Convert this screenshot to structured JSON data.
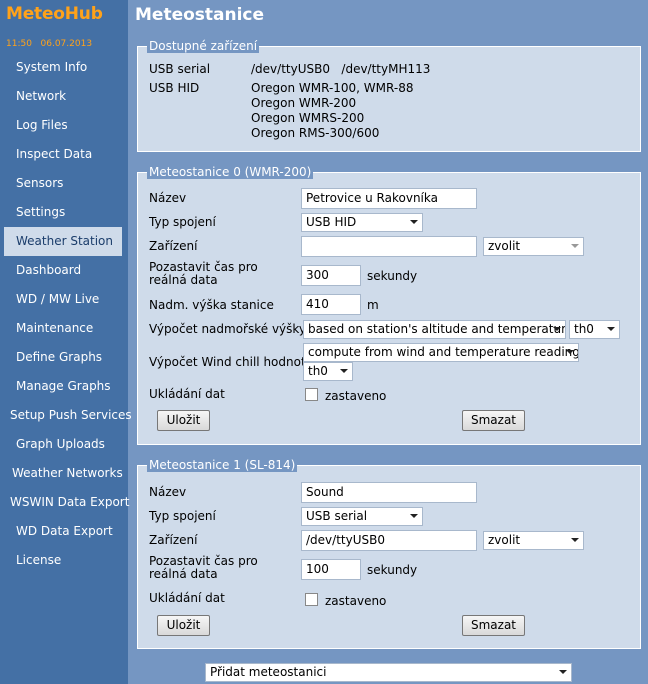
{
  "app": {
    "logo": "MeteoHub",
    "clock": "11:50   06.07.2013"
  },
  "header": {
    "title": "Meteostanice"
  },
  "sidebar": {
    "items": [
      "System Info",
      "Network",
      "Log Files",
      "Inspect Data",
      "Sensors",
      "Settings",
      "Weather Station",
      "Dashboard",
      "WD / MW Live",
      "Maintenance",
      "Define Graphs",
      "Manage Graphs",
      "Setup Push Services",
      "Graph Uploads",
      "Weather Networks",
      "WSWIN Data Export",
      "WD Data Export",
      "License"
    ],
    "active": "Weather Station"
  },
  "devices": {
    "legend": "Dostupné zařízení",
    "usb_serial_label": "USB serial",
    "usb_serial_value": "/dev/ttyUSB0   /dev/ttyMH113",
    "usb_hid_label": "USB HID",
    "usb_hid_values": [
      "Oregon WMR-100, WMR-88",
      "Oregon WMR-200",
      "Oregon WMRS-200",
      "Oregon RMS-300/600"
    ]
  },
  "station0": {
    "legend": "Meteostanice 0 (WMR-200)",
    "name_label": "Název",
    "name_value": "Petrovice u Rakovníka",
    "conn_label": "Typ spojení",
    "conn_value": "USB HID",
    "device_label": "Zařízení",
    "device_value": "",
    "device_select": "zvolit",
    "pause_label": "Pozastavit čas pro reálná data",
    "pause_value": "300",
    "pause_unit": "sekundy",
    "alt_label": "Nadm. výška stanice",
    "alt_value": "410",
    "alt_unit": "m",
    "calc_alt_label": "Výpočet nadmořské výšky",
    "calc_alt_value": "based on station's altitude and temperature",
    "calc_alt_sensor": "th0",
    "windchill_label": "Výpočet Wind chill hodnoty",
    "windchill_value": "compute from wind and temperature readings",
    "windchill_sensor": "th0",
    "storage_label": "Ukládání dat",
    "storage_check": "zastaveno",
    "save": "Uložit",
    "delete": "Smazat"
  },
  "station1": {
    "legend": "Meteostanice 1 (SL-814)",
    "name_label": "Název",
    "name_value": "Sound",
    "conn_label": "Typ spojení",
    "conn_value": "USB serial",
    "device_label": "Zařízení",
    "device_value": "/dev/ttyUSB0",
    "device_select": "zvolit",
    "pause_label": "Pozastavit čas pro reálná data",
    "pause_value": "100",
    "pause_unit": "sekundy",
    "storage_label": "Ukládání dat",
    "storage_check": "zastaveno",
    "save": "Uložit",
    "delete": "Smazat"
  },
  "add_station": "Přidat meteostanici"
}
